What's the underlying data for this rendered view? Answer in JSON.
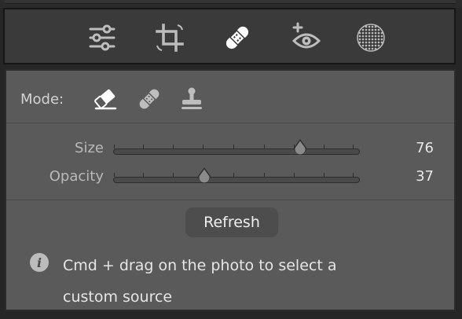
{
  "toolbar": {
    "tools": [
      {
        "icon": "edit-sliders-icon",
        "active": false
      },
      {
        "icon": "crop-icon",
        "active": false
      },
      {
        "icon": "healing-bandage-icon",
        "active": true
      },
      {
        "icon": "red-eye-icon",
        "active": false
      },
      {
        "icon": "masking-icon",
        "active": false
      }
    ]
  },
  "panel": {
    "mode_label": "Mode:",
    "modes": [
      {
        "icon": "content-aware-remove-eraser-icon",
        "active": true
      },
      {
        "icon": "heal-bandage-icon",
        "active": false
      },
      {
        "icon": "clone-stamp-icon",
        "active": false
      }
    ],
    "sliders": [
      {
        "label": "Size",
        "value": "76",
        "fraction": 0.76
      },
      {
        "label": "Opacity",
        "value": "37",
        "fraction": 0.37
      }
    ],
    "refresh_label": "Refresh",
    "info_glyph": "i",
    "info_text": "Cmd + drag on the photo to select a custom source"
  },
  "colors": {
    "panel_bg": "#5a5a5a",
    "toolbar_bg": "#3a3a3a",
    "active_icon": "#ffffff",
    "inactive_icon": "#bdbdbd"
  }
}
